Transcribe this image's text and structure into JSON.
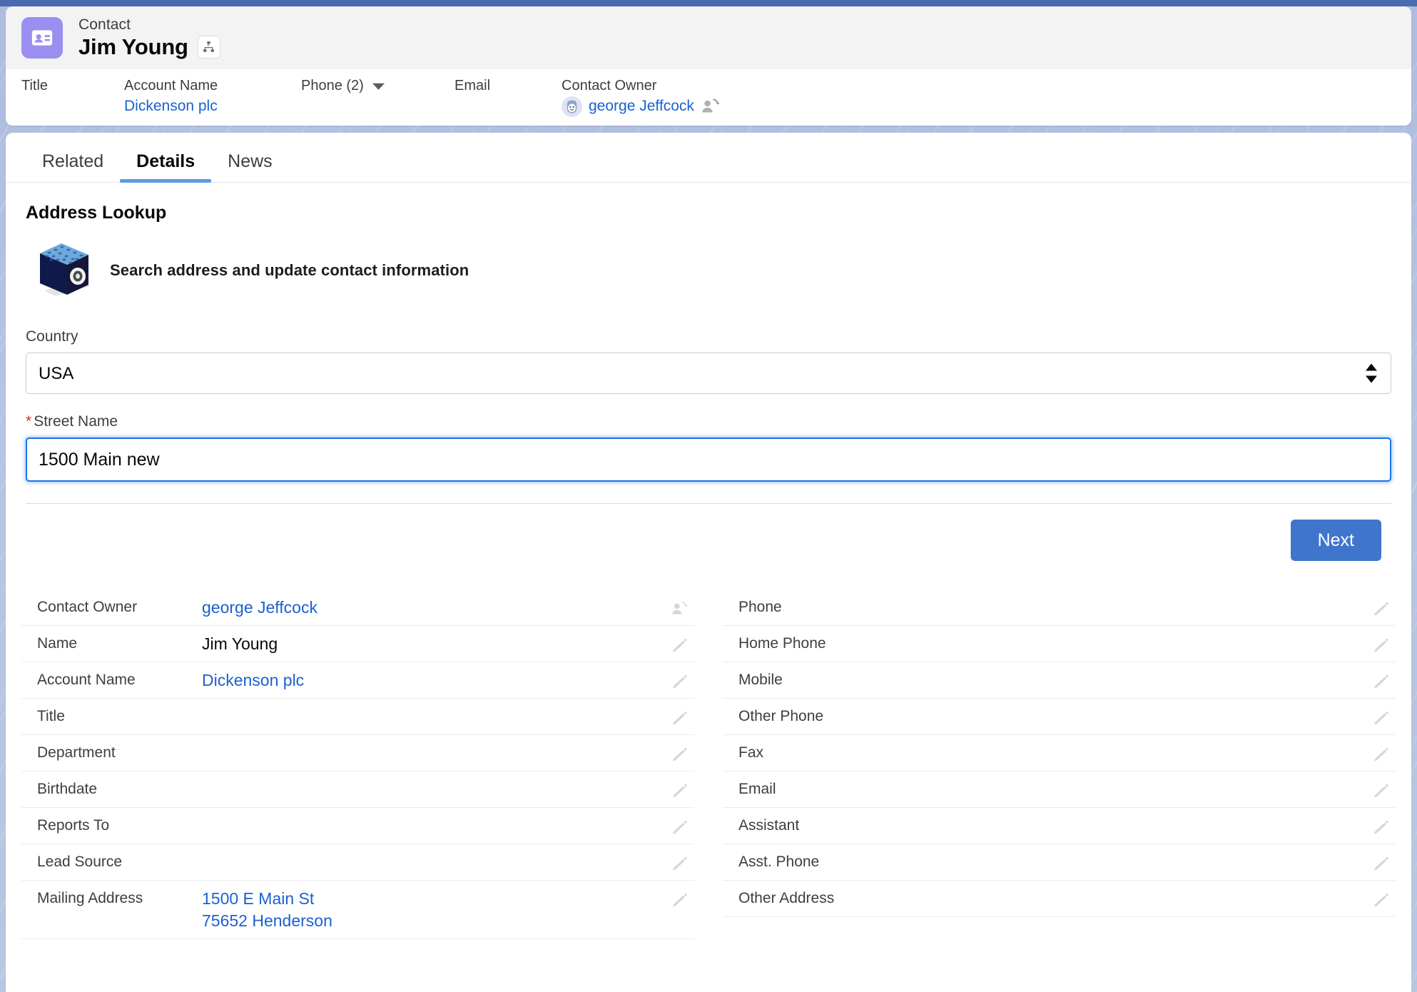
{
  "header": {
    "object_label": "Contact",
    "record_name": "Jim Young",
    "entity_icon": "contact-card-icon",
    "hierarchy_icon": "org-hierarchy-icon",
    "fields": [
      {
        "label": "Title",
        "value": "",
        "type": "text"
      },
      {
        "label": "Account Name",
        "value": "Dickenson plc",
        "type": "link"
      },
      {
        "label": "Phone (2)",
        "value": "",
        "type": "dropdown"
      },
      {
        "label": "Email",
        "value": "",
        "type": "text"
      },
      {
        "label": "Contact Owner",
        "value": "george Jeffcock",
        "type": "owner"
      }
    ]
  },
  "tabs": [
    {
      "label": "Related",
      "active": false
    },
    {
      "label": "Details",
      "active": true
    },
    {
      "label": "News",
      "active": false
    }
  ],
  "address_lookup": {
    "section_title": "Address Lookup",
    "caption": "Search address and update contact information",
    "logo_icon": "blue-cube-logo-icon",
    "country": {
      "label": "Country",
      "value": "USA",
      "options": [
        "USA"
      ]
    },
    "street": {
      "label": "Street Name",
      "required": true,
      "value": "1500 Main new",
      "placeholder": ""
    },
    "next_label": "Next"
  },
  "details": {
    "left_column": [
      {
        "label": "Contact Owner",
        "value": "george Jeffcock",
        "type": "link",
        "action_icon": "change-owner-icon"
      },
      {
        "label": "Name",
        "value": "Jim Young",
        "type": "text",
        "action_icon": "pencil-icon"
      },
      {
        "label": "Account Name",
        "value": "Dickenson plc",
        "type": "link",
        "action_icon": "pencil-icon"
      },
      {
        "label": "Title",
        "value": "",
        "type": "text",
        "action_icon": "pencil-icon"
      },
      {
        "label": "Department",
        "value": "",
        "type": "text",
        "action_icon": "pencil-icon"
      },
      {
        "label": "Birthdate",
        "value": "",
        "type": "text",
        "action_icon": "pencil-icon"
      },
      {
        "label": "Reports To",
        "value": "",
        "type": "text",
        "action_icon": "pencil-icon"
      },
      {
        "label": "Lead Source",
        "value": "",
        "type": "text",
        "action_icon": "pencil-icon"
      },
      {
        "label": "Mailing Address",
        "value": "",
        "type": "address",
        "address_lines": [
          "1500 E Main St",
          "75652 Henderson"
        ],
        "action_icon": "pencil-icon"
      }
    ],
    "right_column": [
      {
        "label": "Phone",
        "value": "",
        "type": "text",
        "action_icon": "pencil-icon"
      },
      {
        "label": "Home Phone",
        "value": "",
        "type": "text",
        "action_icon": "pencil-icon"
      },
      {
        "label": "Mobile",
        "value": "",
        "type": "text",
        "action_icon": "pencil-icon"
      },
      {
        "label": "Other Phone",
        "value": "",
        "type": "text",
        "action_icon": "pencil-icon"
      },
      {
        "label": "Fax",
        "value": "",
        "type": "text",
        "action_icon": "pencil-icon"
      },
      {
        "label": "Email",
        "value": "",
        "type": "text",
        "action_icon": "pencil-icon"
      },
      {
        "label": "Assistant",
        "value": "",
        "type": "text",
        "action_icon": "pencil-icon"
      },
      {
        "label": "Asst. Phone",
        "value": "",
        "type": "text",
        "action_icon": "pencil-icon"
      },
      {
        "label": "Other Address",
        "value": "",
        "type": "text",
        "action_icon": "pencil-icon"
      }
    ]
  },
  "colors": {
    "link": "#1b60d0",
    "primary_button": "#3f76cc",
    "active_tab_underline": "#5a9ae2",
    "entity_icon_bg": "#9a8ef0",
    "required_star": "#c23934",
    "focus_border": "#1b73e8",
    "page_background": "#b9c6e3"
  }
}
